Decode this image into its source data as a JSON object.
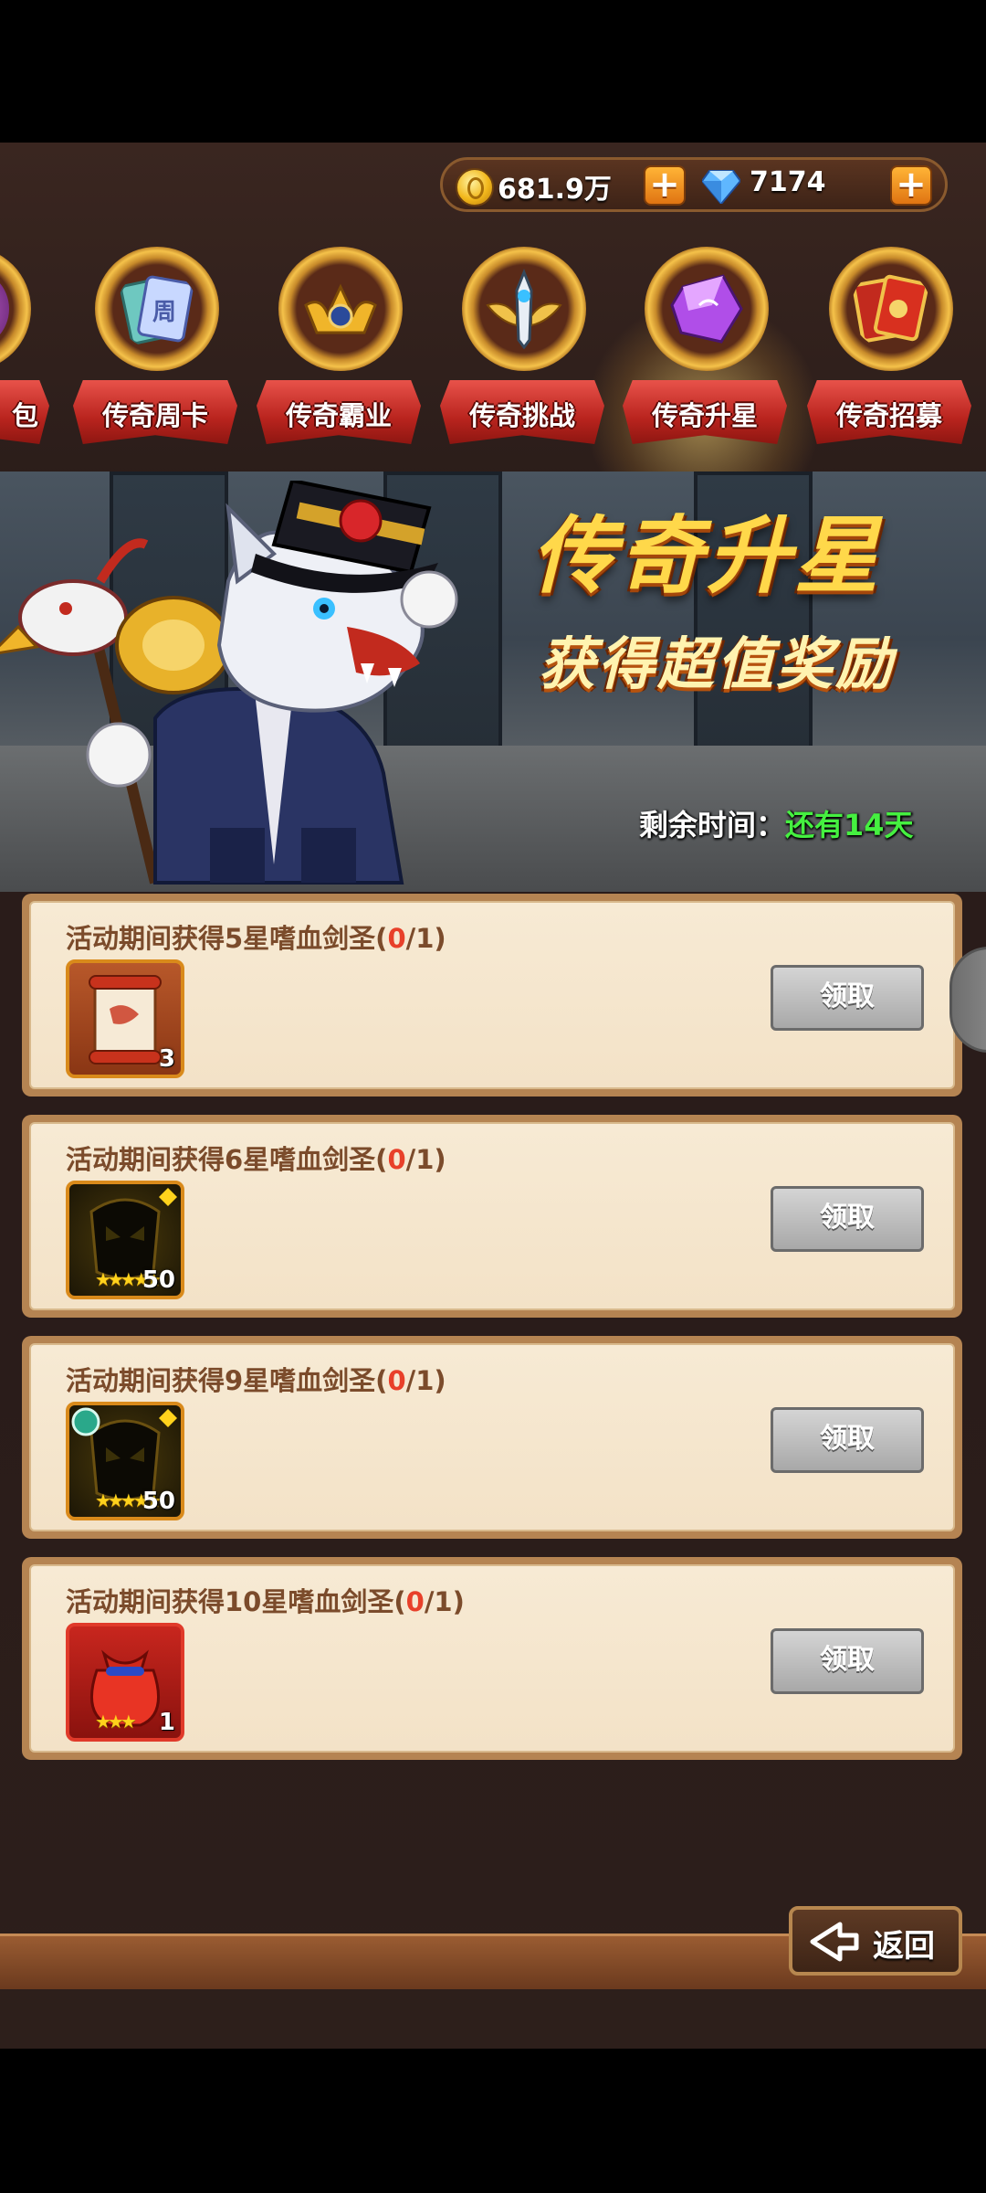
{
  "currency": {
    "gold": "681.9万",
    "diamonds": "7174",
    "add_gold_label": "+",
    "add_diamond_label": "+"
  },
  "tabs": [
    {
      "label": "包",
      "icon": "gift-pack-icon"
    },
    {
      "label": "传奇周卡",
      "icon": "week-card-icon"
    },
    {
      "label": "传奇霸业",
      "icon": "crown-emblem-icon"
    },
    {
      "label": "传奇挑战",
      "icon": "sword-wings-icon"
    },
    {
      "label": "传奇升星",
      "icon": "purple-crystal-icon",
      "selected": true
    },
    {
      "label": "传奇招募",
      "icon": "card-recruit-icon"
    }
  ],
  "banner": {
    "title": "传奇升星",
    "subtitle": "获得超值奖励",
    "timer_label": "剩余时间：",
    "timer_value": "还有14天"
  },
  "tasks": [
    {
      "prefix": "活动期间获得5星嗜血剑圣(",
      "progress": "0",
      "suffix": "/1)",
      "item_count": "3",
      "item_icon": "scroll-icon",
      "stars": "",
      "button": "领取"
    },
    {
      "prefix": "活动期间获得6星嗜血剑圣(",
      "progress": "0",
      "suffix": "/1)",
      "item_count": "50",
      "item_icon": "hero-shard-icon",
      "stars": "★★★★★",
      "button": "领取"
    },
    {
      "prefix": "活动期间获得9星嗜血剑圣(",
      "progress": "0",
      "suffix": "/1)",
      "item_count": "50",
      "item_icon": "hero-shard-icon",
      "stars": "★★★★★",
      "button": "领取"
    },
    {
      "prefix": "活动期间获得10星嗜血剑圣(",
      "progress": "0",
      "suffix": "/1)",
      "item_count": "1",
      "item_icon": "red-bag-icon",
      "stars": "★★★",
      "button": "领取"
    }
  ],
  "footer": {
    "back_label": "返回"
  },
  "colors": {
    "progress_red": "#e8402a",
    "timer_green": "#45f040",
    "title_gold": "#ffd84a"
  }
}
